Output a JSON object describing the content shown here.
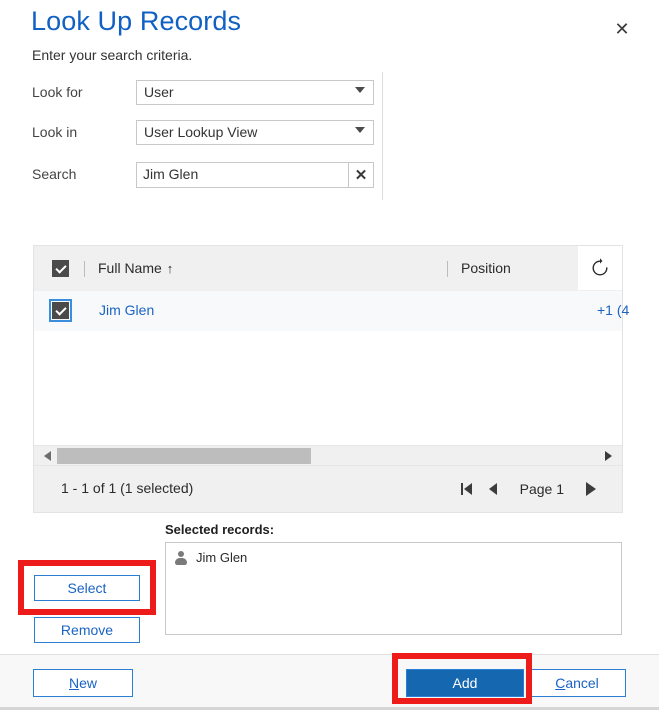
{
  "dialog": {
    "title": "Look Up Records",
    "subtitle": "Enter your search criteria.",
    "close_icon": "close-icon"
  },
  "criteria": {
    "look_for": {
      "label": "Look for",
      "value": "User"
    },
    "look_in": {
      "label": "Look in",
      "value": "User Lookup View"
    },
    "search": {
      "label": "Search",
      "value": "Jim Glen",
      "placeholder": "Search",
      "clear_icon": "✕"
    }
  },
  "grid": {
    "columns": [
      {
        "label": "Full Name",
        "sort": "↑"
      },
      {
        "label": "Position",
        "sort": ""
      }
    ],
    "refresh_icon": "refresh-icon",
    "rows": [
      {
        "name": "Jim Glen",
        "position": "",
        "phone": "+1 (4"
      }
    ],
    "pager": {
      "count_text": "1 - 1 of 1 (1 selected)",
      "page_label": "Page 1",
      "first_icon": "first-page-icon",
      "prev_icon": "previous-page-icon",
      "next_icon": "next-page-icon"
    },
    "scrollbar": {
      "left_icon": "scroll-left-icon",
      "right_icon": "scroll-right-icon"
    }
  },
  "selected": {
    "label": "Selected records:",
    "items": [
      {
        "name": "Jim Glen",
        "icon": "person-icon"
      }
    ]
  },
  "side_actions": {
    "select": "Select",
    "remove": "Remove"
  },
  "footer": {
    "new": "New",
    "new_accel": "N",
    "new_rest": "ew",
    "add": "Add",
    "cancel": "Cancel",
    "cancel_accel": "C",
    "cancel_rest": "ancel"
  },
  "colors": {
    "title_blue": "#1160c4",
    "link_blue": "#1a63c4",
    "button_border_blue": "#2a7fd4",
    "primary_button_bg": "#1567b0",
    "annotation_red": "#ee1b1b",
    "header_gray": "#f0f0f0",
    "row_gray": "#f8f9fb"
  }
}
